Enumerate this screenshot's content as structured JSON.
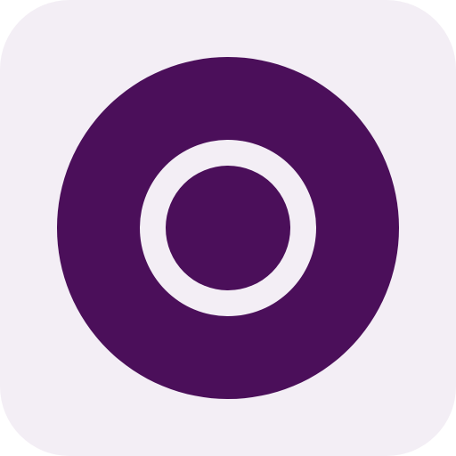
{
  "icon": {
    "name": "concentric-ring-icon",
    "colors": {
      "tile": "#F3EEF5",
      "primary": "#4B0F5A"
    }
  }
}
